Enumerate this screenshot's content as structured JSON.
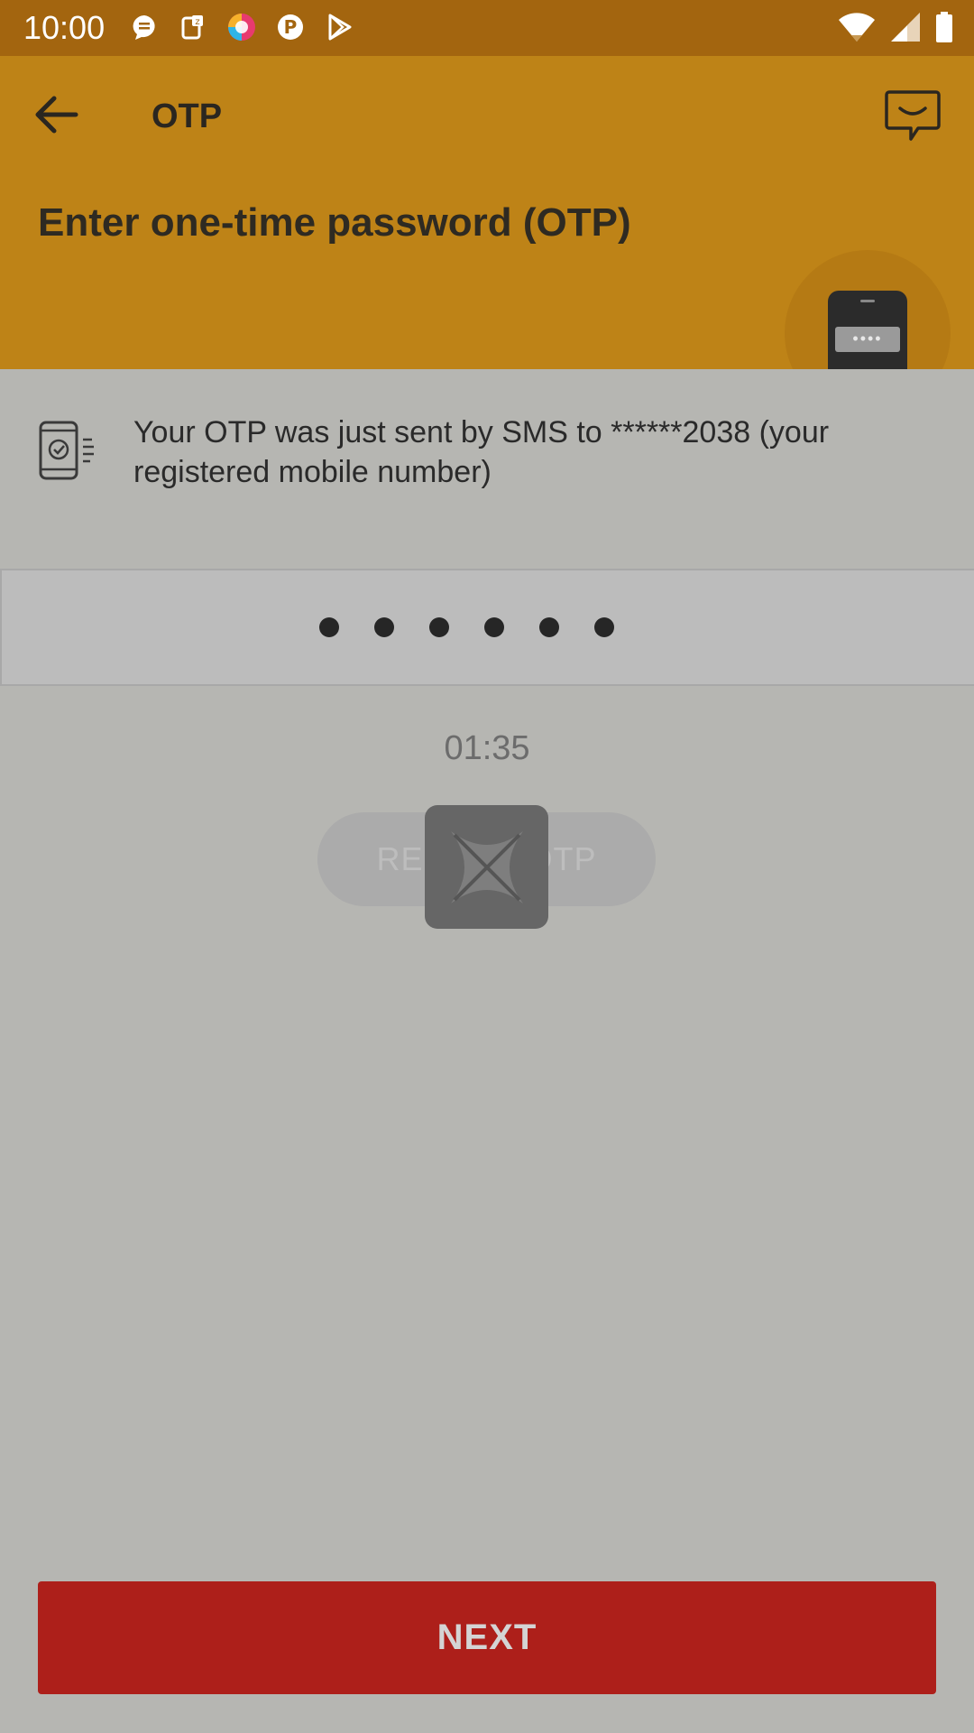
{
  "status_bar": {
    "time": "10:00",
    "notification_icons": [
      "chat-bubble-icon",
      "document-icon",
      "colorful-ball-icon",
      "p-app-icon",
      "play-store-icon"
    ],
    "right_icons": [
      "wifi-icon",
      "signal-icon",
      "battery-icon"
    ]
  },
  "header": {
    "title": "OTP",
    "headline": "Enter one-time password (OTP)",
    "phone_screen_text": "••••",
    "back_icon": "arrow-left-icon",
    "chat_icon": "chat-smile-icon"
  },
  "info": {
    "message": "Your OTP was just sent by SMS to ******2038 (your registered mobile number)",
    "icon": "phone-check-icon"
  },
  "otp": {
    "digits_entered": 6
  },
  "timer": {
    "text": "01:35"
  },
  "resend": {
    "label": "RESEND OTP"
  },
  "loader": {
    "icon": "x-spinner-icon"
  },
  "next": {
    "label": "NEXT"
  },
  "colors": {
    "status_bar": "#a3650f",
    "header_bg": "#be8317",
    "overlay_bg": "#b6b6b2",
    "next_button": "#ad1f1a"
  }
}
